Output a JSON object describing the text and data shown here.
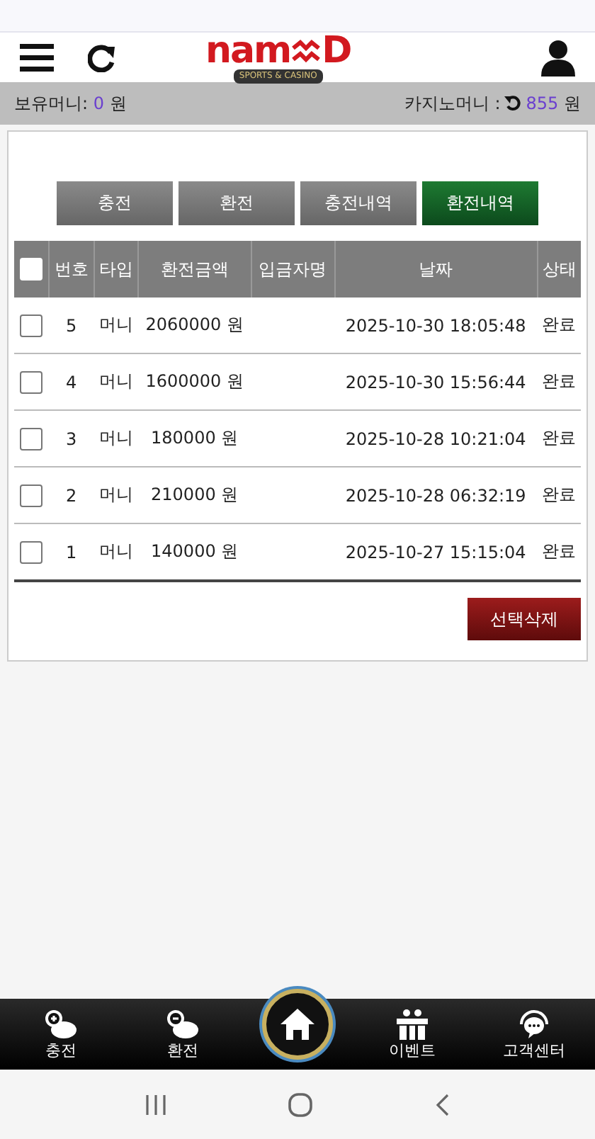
{
  "header": {
    "logo": {
      "left": "nam",
      "right": "D",
      "tagline": "SPORTS & CASINO"
    }
  },
  "balance": {
    "holding_label": "보유머니:",
    "holding_value": "0",
    "holding_unit": "원",
    "casino_label": "카지노머니 :",
    "casino_value": "855",
    "casino_unit": "원"
  },
  "tabs": [
    {
      "label": "충전",
      "selected": false
    },
    {
      "label": "환전",
      "selected": false
    },
    {
      "label": "충전내역",
      "selected": false
    },
    {
      "label": "환전내역",
      "selected": true
    }
  ],
  "table": {
    "select_all_checked": false,
    "columns": [
      "번호",
      "타입",
      "환전금액",
      "입금자명",
      "날짜",
      "상태"
    ],
    "rows": [
      {
        "checked": false,
        "no": "5",
        "type": "머니",
        "amount": "2060000 원",
        "date": "2025-10-30 18:05:48",
        "status": "완료"
      },
      {
        "checked": false,
        "no": "4",
        "type": "머니",
        "amount": "1600000 원",
        "date": "2025-10-30 15:56:44",
        "status": "완료"
      },
      {
        "checked": false,
        "no": "3",
        "type": "머니",
        "amount": "180000 원",
        "date": "2025-10-28 10:21:04",
        "status": "완료"
      },
      {
        "checked": false,
        "no": "2",
        "type": "머니",
        "amount": "210000 원",
        "date": "2025-10-28 06:32:19",
        "status": "완료"
      },
      {
        "checked": false,
        "no": "1",
        "type": "머니",
        "amount": "140000 원",
        "date": "2025-10-27 15:15:04",
        "status": "완료"
      }
    ]
  },
  "delete_button": "선택삭제",
  "bottom_nav": [
    {
      "kind": "deposit",
      "label": "충전"
    },
    {
      "kind": "withdraw",
      "label": "환전"
    },
    {
      "kind": "home"
    },
    {
      "kind": "event",
      "label": "이벤트"
    },
    {
      "kind": "support",
      "label": "고객센터"
    }
  ]
}
